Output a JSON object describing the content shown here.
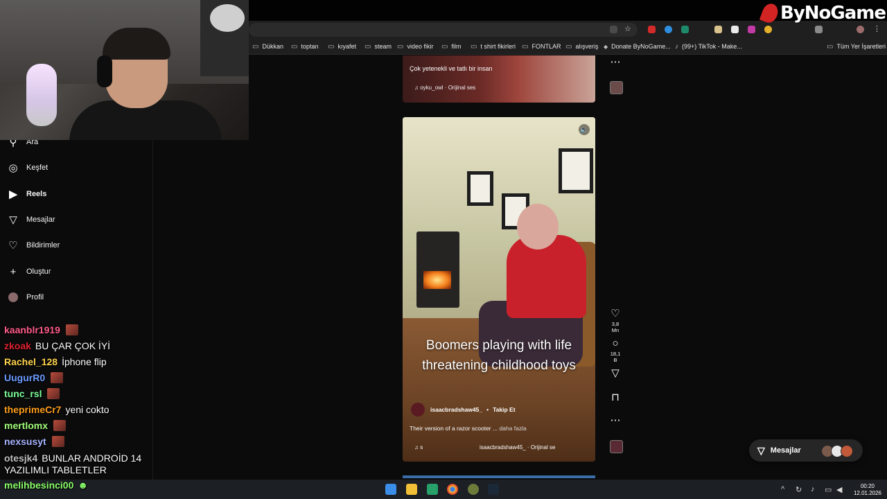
{
  "bookmarks": [
    "Dükkan",
    "toptan",
    "kıyafet",
    "steam",
    "video fikir",
    "film",
    "t shirt fikirleri",
    "FONTLAR",
    "alışveriş",
    "Donate ByNoGame...",
    "(99+) TikTok - Make...",
    "Tüm Yer İşaretleri"
  ],
  "logo": {
    "text": "ByNoGame"
  },
  "nav": [
    {
      "label": "Ara",
      "icon": "search-icon"
    },
    {
      "label": "Keşfet",
      "icon": "compass-icon"
    },
    {
      "label": "Reels",
      "icon": "reels-icon"
    },
    {
      "label": "Mesajlar",
      "icon": "send-icon"
    },
    {
      "label": "Bildirimler",
      "icon": "heart-icon"
    },
    {
      "label": "Oluştur",
      "icon": "plus-icon"
    },
    {
      "label": "Profil",
      "icon": "avatar-icon"
    }
  ],
  "chat": [
    {
      "user": "kaanblr1919",
      "color": "#ff5c8a",
      "text": "",
      "emote": true
    },
    {
      "user": "zkoak",
      "color": "#e0212f",
      "text": "BU ÇAR ÇOK İYİ",
      "emote": false
    },
    {
      "user": "Rachel_128",
      "color": "#ffd34d",
      "text": "İphone flip",
      "emote": false
    },
    {
      "user": "UugurR0",
      "color": "#6b9bff",
      "text": "",
      "emote": true
    },
    {
      "user": "tunc_rsl",
      "color": "#7cff9a",
      "text": "",
      "emote": true
    },
    {
      "user": "theprimeCr7",
      "color": "#ff9f1c",
      "text": "yeni cokto",
      "emote": false
    },
    {
      "user": "mertlomx",
      "color": "#a3ff7a",
      "text": "",
      "emote": true
    },
    {
      "user": "nexsusyt",
      "color": "#a7b4ff",
      "text": "",
      "emote": true
    },
    {
      "user": "otesjk4",
      "color": "#bfbfbf",
      "text": "BUNLAR ANDROİD 14",
      "emote": false
    },
    {
      "user": "",
      "color": "#ffffff",
      "text": "YAZILIMLI TABLETLER",
      "emote": false
    },
    {
      "user": "melihbesinci00",
      "color": "#8bff6a",
      "text": "",
      "emote": false
    }
  ],
  "feed": {
    "post1": {
      "caption": "Çok yetenekli ve tatlı bir insan",
      "audio": "oyku_owl · Orijinal ses"
    },
    "post2": {
      "headline": "Boomers playing with life threatening childhood toys",
      "author": "isaacbradshaw45_",
      "follow": "Takip Et",
      "description": "Their version of a razor scooter ...",
      "more": "daha fazla",
      "audio_prefix": "s",
      "audio": "isaacbradshaw45_ · Orijinal se",
      "likes": "3,8 Mn",
      "comments": "18,1 B"
    }
  },
  "messages_pill": {
    "label": "Mesajlar"
  },
  "clock": {
    "time": "00:20",
    "date": "12.01.2026"
  }
}
